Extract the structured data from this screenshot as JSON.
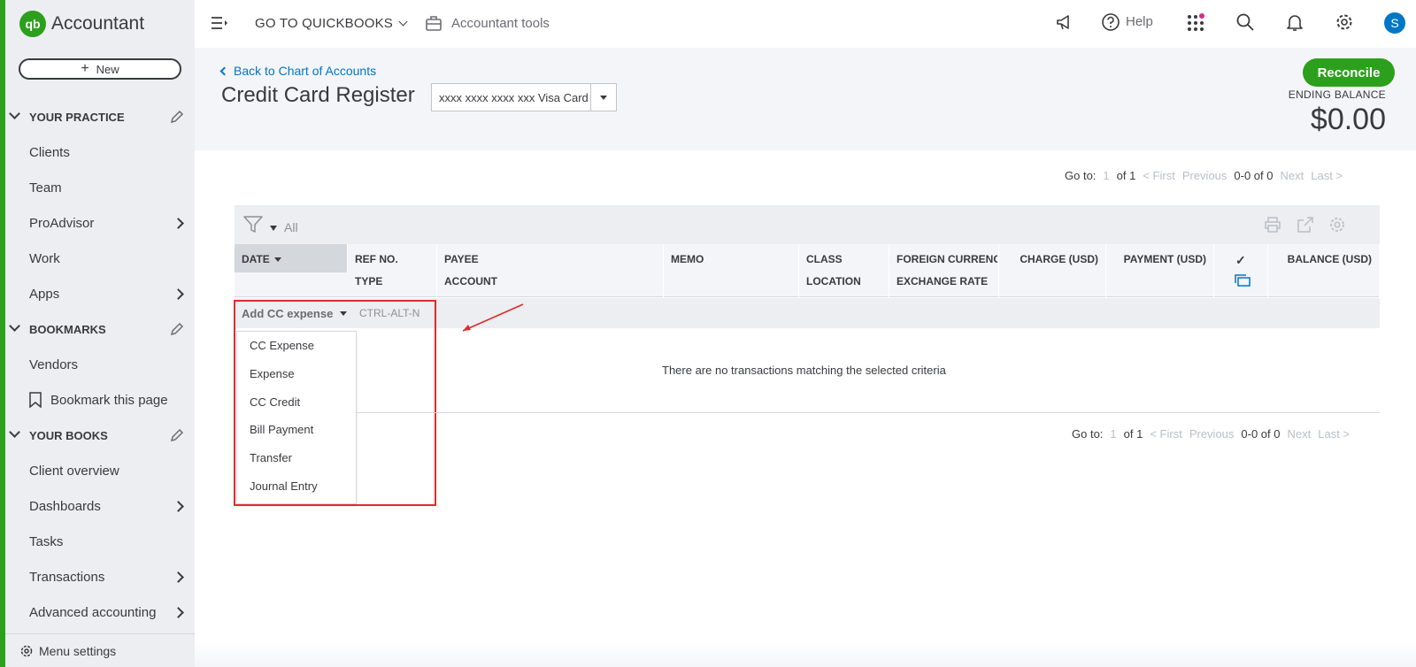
{
  "app": {
    "brand_initials": "qb",
    "brand_name": "Accountant"
  },
  "sidebar": {
    "new_label": "New",
    "sections": {
      "practice": "YOUR PRACTICE",
      "bookmarks": "BOOKMARKS",
      "books": "YOUR BOOKS"
    },
    "practice_items": [
      "Clients",
      "Team",
      "ProAdvisor",
      "Work",
      "Apps"
    ],
    "bookmark_items": [
      "Vendors",
      "Bookmark this page"
    ],
    "books_items": [
      "Client overview",
      "Dashboards",
      "Tasks",
      "Transactions",
      "Advanced accounting"
    ],
    "menu_settings": "Menu settings"
  },
  "topbar": {
    "goto_quickbooks": "GO TO QUICKBOOKS",
    "accountant_tools": "Accountant tools",
    "help": "Help",
    "avatar_initial": "S"
  },
  "header": {
    "back_link": "Back to Chart of Accounts",
    "title": "Credit Card Register",
    "account_value": "xxxx xxxx xxxx xxx Visa Card",
    "reconcile": "Reconcile",
    "ending_balance_label": "ENDING BALANCE",
    "ending_balance_value": "$0.00"
  },
  "pager": {
    "goto": "Go to:",
    "page": "1",
    "of": "of 1",
    "first": "< First",
    "previous": "Previous",
    "range": "0-0 of 0",
    "next": "Next",
    "last": "Last >"
  },
  "grid": {
    "filter_all": "All",
    "columns_row1": [
      "DATE",
      "REF NO.",
      "PAYEE",
      "MEMO",
      "CLASS",
      "FOREIGN CURRENCY",
      "CHARGE (USD)",
      "PAYMENT (USD)",
      "✓",
      "BALANCE (USD)"
    ],
    "columns_row2": [
      "",
      "TYPE",
      "ACCOUNT",
      "",
      "LOCATION",
      "EXCHANGE RATE",
      "",
      "",
      "",
      ""
    ],
    "add_button": "Add CC expense",
    "shortcut": "CTRL-ALT-N",
    "empty_message": "There are no transactions matching the selected criteria"
  },
  "dropdown_options": [
    "CC Expense",
    "Expense",
    "CC Credit",
    "Bill Payment",
    "Transfer",
    "Journal Entry"
  ],
  "colors": {
    "brand_green": "#2ca01c",
    "link_blue": "#0077c5",
    "annotation_red": "#e02b2b"
  }
}
